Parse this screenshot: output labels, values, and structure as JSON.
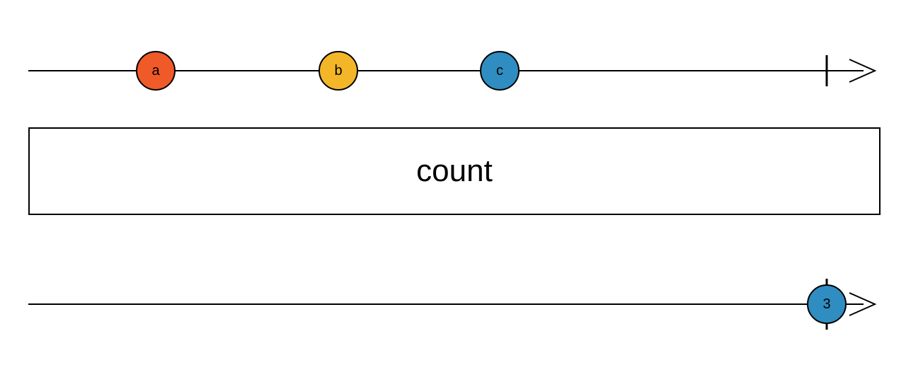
{
  "operator": {
    "label": "count"
  },
  "colors": {
    "orange": "#f05a28",
    "yellow": "#f3b628",
    "blue": "#2f8dc1"
  },
  "source": {
    "marbles": [
      {
        "label": "a",
        "colorKey": "orange",
        "x_pct": 15.0
      },
      {
        "label": "b",
        "colorKey": "yellow",
        "x_pct": 36.5
      },
      {
        "label": "c",
        "colorKey": "blue",
        "x_pct": 55.5
      }
    ],
    "complete_x_pct": 94.0
  },
  "result": {
    "marbles": [
      {
        "label": "3",
        "colorKey": "blue",
        "x_pct": 94.0
      }
    ],
    "complete_x_pct": 94.0
  }
}
